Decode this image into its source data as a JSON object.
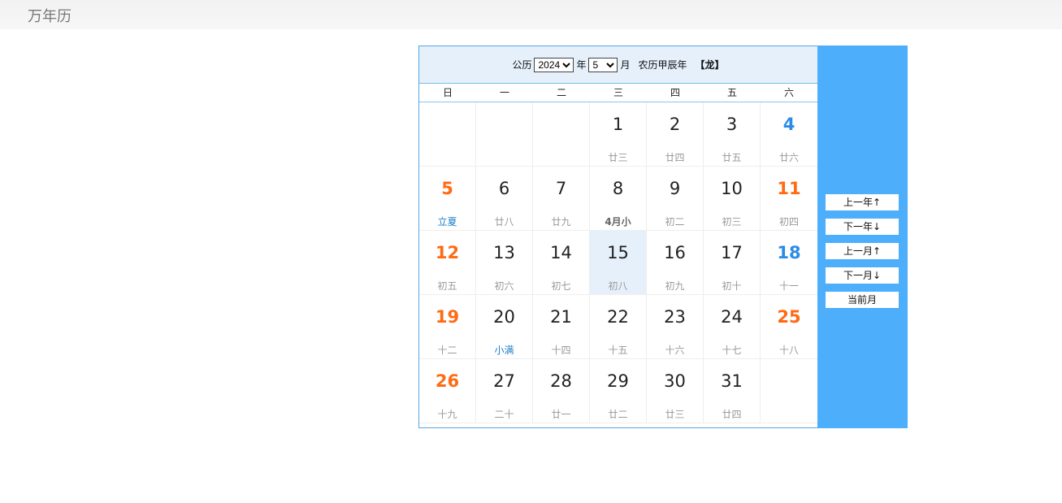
{
  "app": {
    "title": "万年历"
  },
  "header": {
    "solar_label": "公历",
    "year_value": "2024",
    "year_unit": "年",
    "month_value": "5",
    "month_unit": "月",
    "lunar_year": "农历甲辰年",
    "zodiac": "【龙】"
  },
  "weekdays": [
    "日",
    "一",
    "二",
    "三",
    "四",
    "五",
    "六"
  ],
  "days": [
    {
      "num": "",
      "lunar": ""
    },
    {
      "num": "",
      "lunar": ""
    },
    {
      "num": "",
      "lunar": ""
    },
    {
      "num": "1",
      "lunar": "廿三"
    },
    {
      "num": "2",
      "lunar": "廿四"
    },
    {
      "num": "3",
      "lunar": "廿五"
    },
    {
      "num": "4",
      "lunar": "廿六",
      "style": "blue"
    },
    {
      "num": "5",
      "lunar": "立夏",
      "style": "red",
      "lunar_style": "term"
    },
    {
      "num": "6",
      "lunar": "廿八"
    },
    {
      "num": "7",
      "lunar": "廿九"
    },
    {
      "num": "8",
      "lunar": "4月小",
      "lunar_style": "month"
    },
    {
      "num": "9",
      "lunar": "初二"
    },
    {
      "num": "10",
      "lunar": "初三"
    },
    {
      "num": "11",
      "lunar": "初四",
      "style": "red"
    },
    {
      "num": "12",
      "lunar": "初五",
      "style": "red"
    },
    {
      "num": "13",
      "lunar": "初六"
    },
    {
      "num": "14",
      "lunar": "初七"
    },
    {
      "num": "15",
      "lunar": "初八",
      "today": true
    },
    {
      "num": "16",
      "lunar": "初九"
    },
    {
      "num": "17",
      "lunar": "初十"
    },
    {
      "num": "18",
      "lunar": "十一",
      "style": "blue"
    },
    {
      "num": "19",
      "lunar": "十二",
      "style": "red"
    },
    {
      "num": "20",
      "lunar": "小满",
      "lunar_style": "term"
    },
    {
      "num": "21",
      "lunar": "十四"
    },
    {
      "num": "22",
      "lunar": "十五"
    },
    {
      "num": "23",
      "lunar": "十六"
    },
    {
      "num": "24",
      "lunar": "十七"
    },
    {
      "num": "25",
      "lunar": "十八",
      "style": "red"
    },
    {
      "num": "26",
      "lunar": "十九",
      "style": "red"
    },
    {
      "num": "27",
      "lunar": "二十"
    },
    {
      "num": "28",
      "lunar": "廿一"
    },
    {
      "num": "29",
      "lunar": "廿二"
    },
    {
      "num": "30",
      "lunar": "廿三"
    },
    {
      "num": "31",
      "lunar": "廿四"
    },
    {
      "num": "",
      "lunar": ""
    }
  ],
  "sidebar": {
    "prev_year": "上一年↑",
    "next_year": "下一年↓",
    "prev_month": "上一月↑",
    "next_month": "下一月↓",
    "current_month": "当前月"
  },
  "colors": {
    "weekend_red": "#ff6a13",
    "holiday_blue": "#2b8be6",
    "sidebar_bg": "#4daefb",
    "header_bg": "#e5f0fb"
  }
}
